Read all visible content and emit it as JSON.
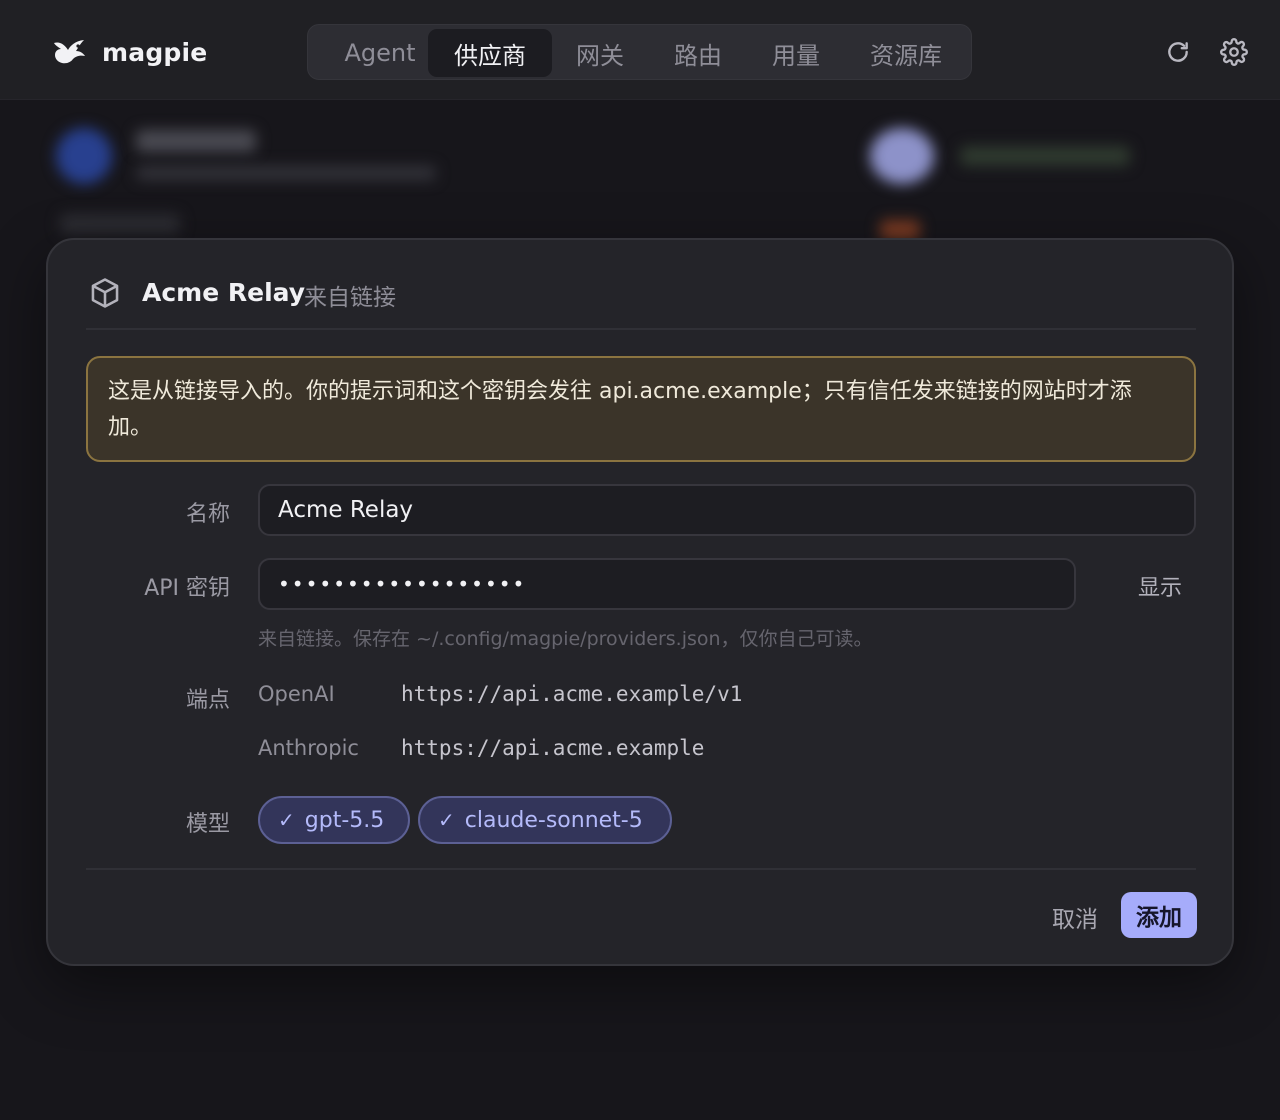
{
  "app": {
    "name": "magpie",
    "logo_icon": "magpie-bird-logo",
    "nav_tabs": [
      {
        "label": "Agent",
        "active": false
      },
      {
        "label": "供应商",
        "active": true
      },
      {
        "label": "网关",
        "active": false
      },
      {
        "label": "路由",
        "active": false
      },
      {
        "label": "用量",
        "active": false
      },
      {
        "label": "资源库",
        "active": false
      }
    ],
    "actions": [
      "refresh-icon",
      "settings-gear-icon"
    ]
  },
  "dialog": {
    "header_icon": "package-cube-icon",
    "title": "Acme Relay",
    "source_tag": "来自链接",
    "warning": "这是从链接导入的。你的提示词和这个密钥会发往 api.acme.example；只有信任发来链接的网站时才添加。",
    "name_field": {
      "label": "名称",
      "value": "Acme Relay"
    },
    "api_key_field": {
      "label": "API 密钥",
      "value": "••••••••••••••••••",
      "show_label": "显示"
    },
    "key_hint": "来自链接。保存在 ~/.config/magpie/providers.json，仅你自己可读。",
    "endpoints": {
      "label": "端点",
      "items": [
        {
          "name": "OpenAI",
          "url": "https://api.acme.example/v1"
        },
        {
          "name": "Anthropic",
          "url": "https://api.acme.example"
        }
      ]
    },
    "models": {
      "label": "模型",
      "chips": [
        {
          "label": "gpt-5.5",
          "selected": true
        },
        {
          "label": "claude-sonnet-5",
          "selected": true
        }
      ]
    },
    "buttons": {
      "cancel": "取消",
      "add": "添加"
    }
  },
  "colors": {
    "accent": "#a6acfb",
    "warning_border": "#8b7440",
    "warning_bg": "#3b3429",
    "chip_bg": "#33355a"
  }
}
